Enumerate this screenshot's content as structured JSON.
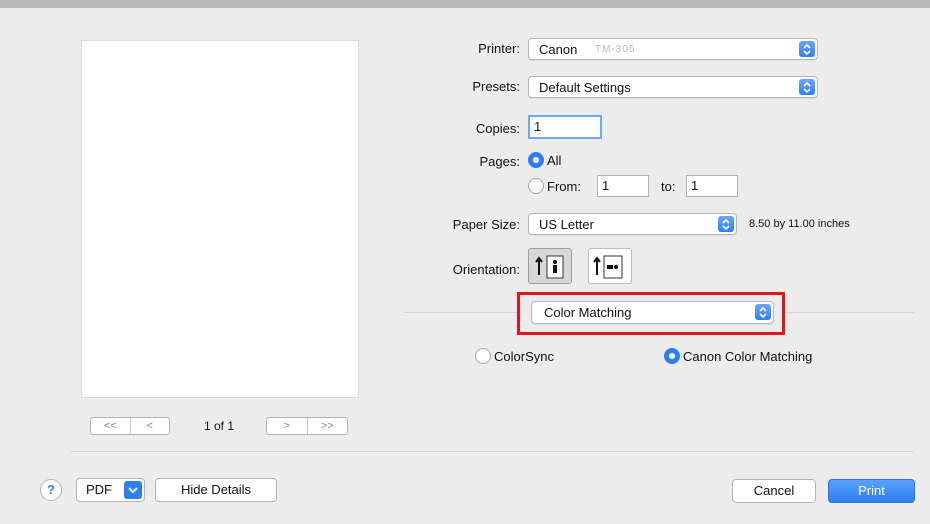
{
  "form": {
    "printer_label": "Printer:",
    "printer_value": "Canon",
    "printer_model_blurred": "TM-305",
    "presets_label": "Presets:",
    "presets_value": "Default Settings",
    "copies_label": "Copies:",
    "copies_value": "1",
    "pages_label": "Pages:",
    "pages_all": "All",
    "pages_from": "From:",
    "from_value": "1",
    "to_label": "to:",
    "to_value": "1",
    "paper_size_label": "Paper Size:",
    "paper_size_value": "US Letter",
    "paper_size_dims": "8.50 by 11.00 inches",
    "orientation_label": "Orientation:",
    "section_value": "Color Matching",
    "colorsync": "ColorSync",
    "canon_color_matching": "Canon Color Matching"
  },
  "preview": {
    "page_indicator": "1 of 1",
    "first": "<<",
    "prev": "<",
    "next": ">",
    "last": ">>"
  },
  "footer": {
    "help": "?",
    "pdf": "PDF",
    "hide_details": "Hide Details",
    "cancel": "Cancel",
    "print": "Print"
  },
  "colors": {
    "accent": "#2d7ff3",
    "highlight_box": "#e0161d"
  }
}
